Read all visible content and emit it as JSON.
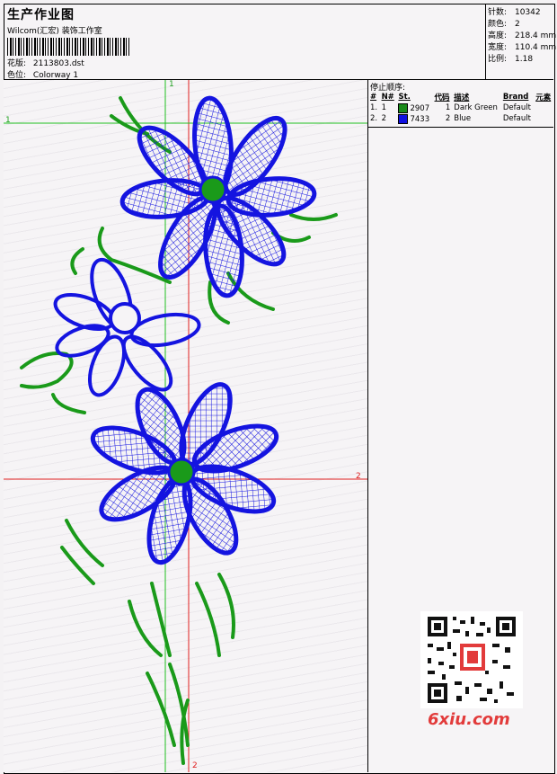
{
  "header": {
    "title": "生产作业图",
    "company": "Wilcom(汇宏) 装饰工作室",
    "pattern_label": "花版:",
    "pattern_value": "2113803.dst",
    "colorway_label": "色位:",
    "colorway_value": "Colorway 1"
  },
  "stats": {
    "stitches_label": "针数:",
    "stitches_value": "10342",
    "colors_label": "颜色:",
    "colors_value": "2",
    "height_label": "高度:",
    "height_value": "218.4 mm",
    "width_label": "宽度:",
    "width_value": "110.4 mm",
    "scale_label": "比例:",
    "scale_value": "1.18"
  },
  "stops": {
    "title": "停止顺序:",
    "headers": [
      "#",
      "N#",
      "St.",
      "代码",
      "描述",
      "Brand",
      "元素"
    ],
    "rows": [
      {
        "index": "1.",
        "n": "1",
        "st": "2907",
        "code": "1",
        "desc": "Dark Green",
        "brand": "Default",
        "color": "#1a8a1a"
      },
      {
        "index": "2.",
        "n": "2",
        "st": "7433",
        "code": "2",
        "desc": "Blue",
        "brand": "Default",
        "color": "#1010e0"
      }
    ]
  },
  "markers": {
    "v1": "1",
    "h1": "1",
    "h2": "2",
    "v2": "2"
  },
  "watermark": "6xiu.com",
  "colors": {
    "blue": "#1414e0",
    "green": "#1a9a1a",
    "guide_red": "#e02020",
    "guide_green": "#20c020"
  }
}
